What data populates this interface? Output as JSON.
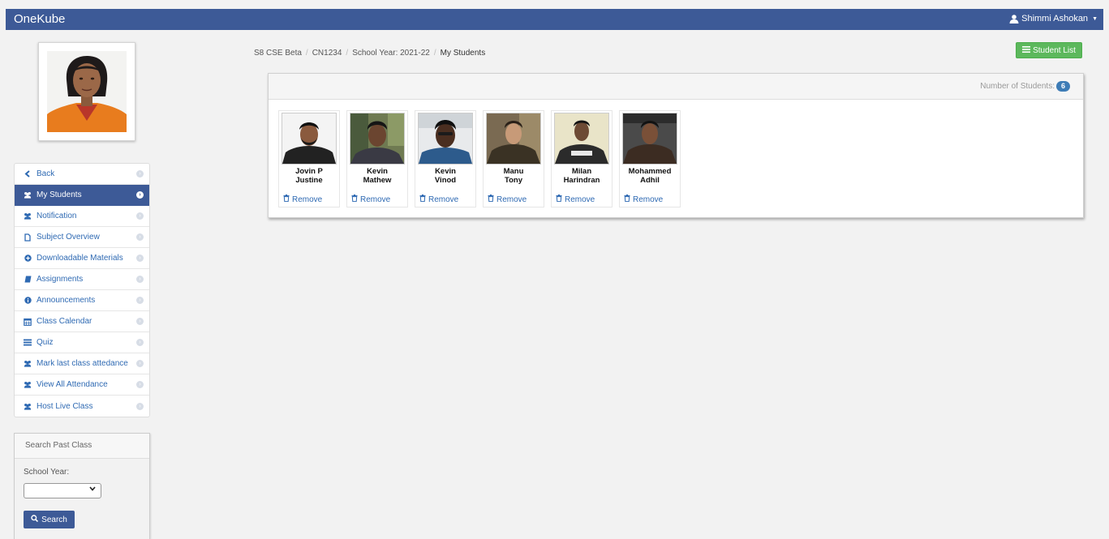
{
  "navbar": {
    "brand": "OneKube",
    "user_name": "Shimmi Ashokan"
  },
  "sidebar": {
    "menu": [
      {
        "label": "Back",
        "icon": "chevron-left-icon",
        "active": false
      },
      {
        "label": "My Students",
        "icon": "users-icon",
        "active": true
      },
      {
        "label": "Notification",
        "icon": "users-icon",
        "active": false
      },
      {
        "label": "Subject Overview",
        "icon": "file-icon",
        "active": false
      },
      {
        "label": "Downloadable Materials",
        "icon": "plus-circle-icon",
        "active": false
      },
      {
        "label": "Assignments",
        "icon": "book-icon",
        "active": false
      },
      {
        "label": "Announcements",
        "icon": "info-icon",
        "active": false
      },
      {
        "label": "Class Calendar",
        "icon": "calendar-icon",
        "active": false
      },
      {
        "label": "Quiz",
        "icon": "list-icon",
        "active": false
      },
      {
        "label": "Mark last class attedance",
        "icon": "users-icon",
        "active": false
      },
      {
        "label": "View All Attendance",
        "icon": "users-icon",
        "active": false
      },
      {
        "label": "Host Live Class",
        "icon": "users-icon",
        "active": false
      }
    ],
    "search_panel": {
      "title": "Search Past Class",
      "school_year_label": "School Year:",
      "selected_year": "",
      "search_label": "Search"
    }
  },
  "breadcrumb": [
    "S8 CSE Beta",
    "CN1234",
    "School Year: 2021-22",
    "My Students"
  ],
  "student_list_label": "Student List",
  "students_panel": {
    "count_label": "Number of Students:",
    "count": "6",
    "remove_label": "Remove",
    "students": [
      {
        "first": "Jovin P",
        "last": "Justine"
      },
      {
        "first": "Kevin",
        "last": "Mathew"
      },
      {
        "first": "Kevin",
        "last": "Vinod"
      },
      {
        "first": "Manu",
        "last": "Tony"
      },
      {
        "first": "Milan",
        "last": "Harindran"
      },
      {
        "first": "Mohammed",
        "last": "Adhil"
      }
    ]
  },
  "colors": {
    "primary": "#3d5a97",
    "success": "#5cb85c",
    "link": "#2f6ab3",
    "badge": "#3d7cb6"
  }
}
